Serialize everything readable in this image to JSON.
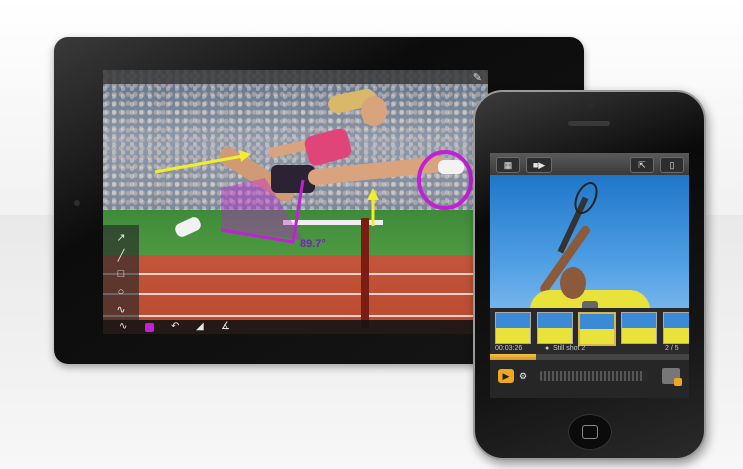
{
  "ipad": {
    "annotation_angle": "89.7°",
    "toolbar_icons": [
      "pencil-icon"
    ],
    "drawing_tools": [
      "arrow-icon",
      "line-icon",
      "rectangle-icon",
      "circle-icon",
      "freehand-icon"
    ],
    "bottom_tools": [
      "curve-icon",
      "color-swatch",
      "undo-icon",
      "eraser-icon",
      "angle-icon"
    ],
    "colors": {
      "annotation_purple": "#c21fd6",
      "arrow_yellow": "#f2ec2a"
    }
  },
  "iphone": {
    "toolbar": {
      "left_icons": [
        "grid-icon",
        "video-camera-icon"
      ],
      "right_icons": [
        "share-icon",
        "trash-icon"
      ]
    },
    "timeline": {
      "time": "00:03:26",
      "shot_label": "Still shot 2",
      "count": "2 / 5",
      "progress": 0.23
    },
    "accent_color": "#f0a623"
  }
}
